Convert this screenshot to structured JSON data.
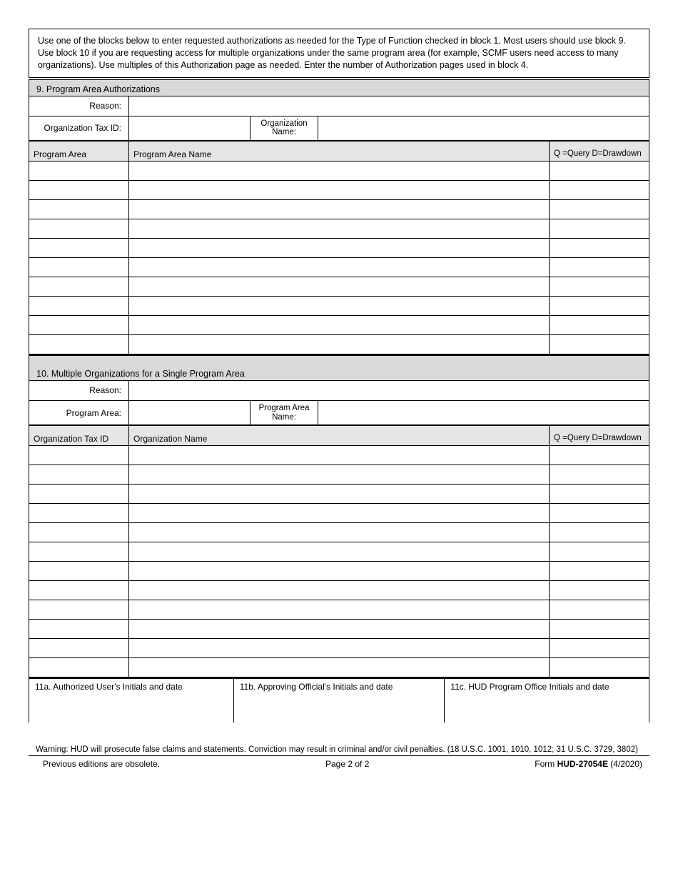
{
  "instructions": "Use one of the blocks below to enter requested authorizations as needed for the Type of Function checked in block 1.  Most users should use block 9.  Use block 10 if you are requesting access for multiple organizations under the same program area (for example, SCMF users need access to many organizations).  Use multiples of this Authorization page as needed.  Enter the number of Authorization pages used in block 4.",
  "section9": {
    "title": "9. Program Area Authorizations",
    "reason_label": "Reason:",
    "tax_id_label": "Organization Tax ID:",
    "org_name_label": "Organization Name:",
    "col1": "Program Area",
    "col2": "Program Area Name",
    "qd": "Q =Query D=Drawdown",
    "row_count": 10
  },
  "section10": {
    "title": "10.  Multiple Organizations for a Single Program Area",
    "reason_label": "Reason:",
    "program_area_label": "Program Area:",
    "program_area_name_label": "Program Area Name:",
    "col1": "Organization Tax ID",
    "col2": "Organization Name",
    "qd": "Q =Query D=Drawdown",
    "row_count": 12
  },
  "signatures": {
    "a": "11a. Authorized User's Initials and date",
    "b": "11b. Approving Official's Initials and date",
    "c": "11c. HUD Program Office Initials and date"
  },
  "warning": "Warning:  HUD will prosecute false claims and statements. Conviction may result in criminal and/or civil penalties. (18 U.S.C. 1001, 1010, 1012; 31 U.S.C. 3729, 3802)",
  "footer": {
    "left": "Previous editions are obsolete.",
    "center": "Page 2 of 2",
    "form_prefix": "Form ",
    "form_num": "HUD-27054E",
    "form_suffix": " (4/2020)"
  }
}
